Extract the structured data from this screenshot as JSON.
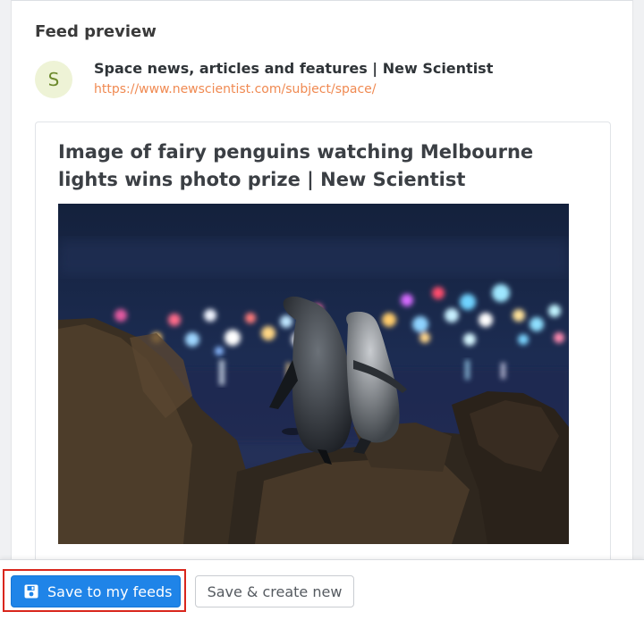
{
  "preview": {
    "section_title": "Feed preview",
    "feed": {
      "avatar_letter": "S",
      "name": "Space news, articles and features | New Scientist",
      "url": "https://www.newscientist.com/subject/space/"
    },
    "article": {
      "title": "Image of fairy penguins watching Melbourne lights wins photo prize | New Scientist",
      "image_icon": "photo-penguins-city-lights"
    }
  },
  "footer": {
    "save_label": "Save to my feeds",
    "save_icon": "floppy-disk-icon",
    "save_create_label": "Save & create new"
  },
  "colors": {
    "primary": "#1f84e8",
    "url": "#f08a52",
    "focus": "#d9261c"
  }
}
